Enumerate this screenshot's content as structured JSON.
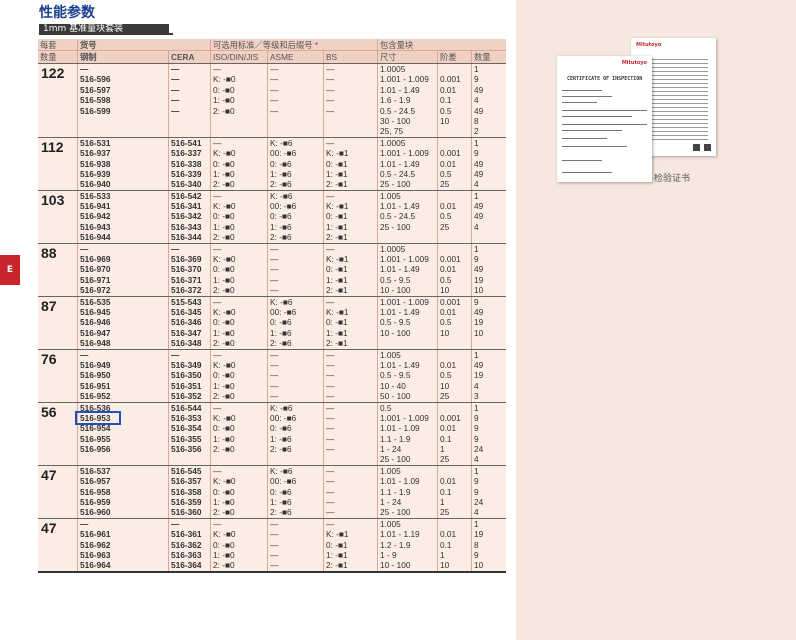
{
  "page": {
    "title": "性能参数",
    "subtitle": "1mm 基准量块套装",
    "side_tab": "E",
    "certificate_caption": "检验证书",
    "certificate_title": "CERTIFICATE OF INSPECTION",
    "certificate_logo": "Mitutoyo"
  },
  "table": {
    "headers": {
      "qty": "每套",
      "qty2": "数量",
      "part_no": "货号",
      "steel": "钢制",
      "cera": "CERA",
      "grade": "可选用标准／等级和后缀号 *",
      "iso": "ISO/DIN/JIS",
      "asme": "ASME",
      "bs": "BS",
      "blocks": "包含量块",
      "size": "尺寸",
      "step": "阶差",
      "count": "数量"
    },
    "groups": [
      {
        "qty": "122",
        "steel": [
          "—",
          "516-596",
          "516-597",
          "516-598",
          "516-599"
        ],
        "cera": [
          "—",
          "—",
          "—",
          "—",
          "—"
        ],
        "iso": [
          "—",
          "K: -■0",
          "0: -■0",
          "1: -■0",
          "2: -■0"
        ],
        "asme": [
          "—",
          "—",
          "—",
          "—",
          "—"
        ],
        "bs": [
          "—",
          "—",
          "—",
          "—",
          "—"
        ],
        "size": [
          "1.0005",
          "1.001 - 1.009",
          "1.01 - 1.49",
          "1.6 - 1.9",
          "0.5 - 24.5",
          "30 - 100",
          "25, 75"
        ],
        "step": [
          "",
          "0.001",
          "0.01",
          "0.1",
          "0.5",
          "10",
          ""
        ],
        "count": [
          "1",
          "9",
          "49",
          "4",
          "49",
          "8",
          "2"
        ]
      },
      {
        "qty": "112",
        "steel": [
          "516-531",
          "516-937",
          "516-938",
          "516-939",
          "516-940"
        ],
        "cera": [
          "516-541",
          "516-337",
          "516-338",
          "516-339",
          "516-340"
        ],
        "iso": [
          "—",
          "K: -■0",
          "0: -■0",
          "1: -■0",
          "2: -■0"
        ],
        "asme": [
          "K: -■6",
          "00: -■6",
          "0: -■6",
          "1: -■6",
          "2: -■6"
        ],
        "bs": [
          "—",
          "K: -■1",
          "0: -■1",
          "1: -■1",
          "2: -■1"
        ],
        "size": [
          "1.0005",
          "1.001 - 1.009",
          "1.01 - 1.49",
          "0.5 - 24.5",
          "25 - 100"
        ],
        "step": [
          "",
          "0.001",
          "0.01",
          "0.5",
          "25"
        ],
        "count": [
          "1",
          "9",
          "49",
          "49",
          "4"
        ]
      },
      {
        "qty": "103",
        "steel": [
          "516-533",
          "516-941",
          "516-942",
          "516-943",
          "516-944"
        ],
        "cera": [
          "516-542",
          "516-341",
          "516-342",
          "516-343",
          "516-344"
        ],
        "iso": [
          "—",
          "K: -■0",
          "0: -■0",
          "1: -■0",
          "2: -■0"
        ],
        "asme": [
          "K: -■6",
          "00: -■6",
          "0: -■6",
          "1: -■6",
          "2: -■6"
        ],
        "bs": [
          "—",
          "K: -■1",
          "0: -■1",
          "1: -■1",
          "2: -■1"
        ],
        "size": [
          "1.005",
          "1.01 - 1.49",
          "0.5 - 24.5",
          "25 - 100",
          ""
        ],
        "step": [
          "",
          "0.01",
          "0.5",
          "25",
          ""
        ],
        "count": [
          "1",
          "49",
          "49",
          "4",
          ""
        ]
      },
      {
        "qty": "88",
        "steel": [
          "—",
          "516-969",
          "516-970",
          "516-971",
          "516-972"
        ],
        "cera": [
          "—",
          "516-369",
          "516-370",
          "516-371",
          "516-372"
        ],
        "iso": [
          "—",
          "K: -■0",
          "0: -■0",
          "1: -■0",
          "2: -■0"
        ],
        "asme": [
          "—",
          "—",
          "—",
          "—",
          "—"
        ],
        "bs": [
          "—",
          "K: -■1",
          "0: -■1",
          "1: -■1",
          "2: -■1"
        ],
        "size": [
          "1.0005",
          "1.001 - 1.009",
          "1.01 - 1.49",
          "0.5 - 9.5",
          "10 - 100"
        ],
        "step": [
          "",
          "0.001",
          "0.01",
          "0.5",
          "10"
        ],
        "count": [
          "1",
          "9",
          "49",
          "19",
          "10"
        ]
      },
      {
        "qty": "87",
        "steel": [
          "516-535",
          "516-945",
          "516-946",
          "516-947",
          "516-948"
        ],
        "cera": [
          "515-543",
          "516-345",
          "516-346",
          "516-347",
          "516-348"
        ],
        "iso": [
          "—",
          "K: -■0",
          "0: -■0",
          "1: -■0",
          "2: -■0"
        ],
        "asme": [
          "K: -■6",
          "00: -■6",
          "0: -■6",
          "1: -■6",
          "2: -■6"
        ],
        "bs": [
          "—",
          "K: -■1",
          "0: -■1",
          "1: -■1",
          "2: -■1"
        ],
        "size": [
          "1.001 - 1.009",
          "1.01 - 1.49",
          "0.5 - 9.5",
          "10 - 100",
          ""
        ],
        "step": [
          "0.001",
          "0.01",
          "0.5",
          "10",
          ""
        ],
        "count": [
          "9",
          "49",
          "19",
          "10",
          ""
        ]
      },
      {
        "qty": "76",
        "steel": [
          "—",
          "516-949",
          "516-950",
          "516-951",
          "516-952"
        ],
        "cera": [
          "—",
          "516-349",
          "516-350",
          "516-351",
          "516-352"
        ],
        "iso": [
          "—",
          "K: -■0",
          "0: -■0",
          "1: -■0",
          "2: -■0"
        ],
        "asme": [
          "—",
          "—",
          "—",
          "—",
          "—"
        ],
        "bs": [
          "—",
          "—",
          "—",
          "—",
          "—"
        ],
        "size": [
          "1.005",
          "1.01 - 1.49",
          "0.5 - 9.5",
          "10 - 40",
          "50 - 100"
        ],
        "step": [
          "",
          "0.01",
          "0.5",
          "10",
          "25"
        ],
        "count": [
          "1",
          "49",
          "19",
          "4",
          "3"
        ]
      },
      {
        "qty": "56",
        "steel": [
          "516-536",
          "516-953",
          "516-954",
          "516-955",
          "516-956"
        ],
        "cera": [
          "516-544",
          "516-353",
          "516-354",
          "516-355",
          "516-356"
        ],
        "iso": [
          "—",
          "K: -■0",
          "0: -■0",
          "1: -■0",
          "2: -■0"
        ],
        "asme": [
          "K: -■6",
          "00: -■6",
          "0: -■6",
          "1: -■6",
          "2: -■6"
        ],
        "bs": [
          "—",
          "—",
          "—",
          "—",
          "—"
        ],
        "size": [
          "0.5",
          "1.001 - 1.009",
          "1.01 - 1.09",
          "1.1 - 1.9",
          "1 - 24",
          "25 - 100"
        ],
        "step": [
          "",
          "0.001",
          "0.01",
          "0.1",
          "1",
          "25"
        ],
        "count": [
          "1",
          "9",
          "9",
          "9",
          "24",
          "4"
        ]
      },
      {
        "qty": "47",
        "steel": [
          "516-537",
          "516-957",
          "516-958",
          "516-959",
          "516-960"
        ],
        "cera": [
          "516-545",
          "516-357",
          "516-358",
          "516-359",
          "516-360"
        ],
        "iso": [
          "—",
          "K: -■0",
          "0: -■0",
          "1: -■0",
          "2: -■0"
        ],
        "asme": [
          "K: -■6",
          "00: -■6",
          "0: -■6",
          "1: -■6",
          "2: -■6"
        ],
        "bs": [
          "—",
          "—",
          "—",
          "—",
          "—"
        ],
        "size": [
          "1.005",
          "1.01 - 1.09",
          "1.1 - 1.9",
          "1 - 24",
          "25 - 100"
        ],
        "step": [
          "",
          "0.01",
          "0.1",
          "1",
          "25"
        ],
        "count": [
          "1",
          "9",
          "9",
          "24",
          "4"
        ]
      },
      {
        "qty": "47",
        "steel": [
          "—",
          "516-961",
          "516-962",
          "516-963",
          "516-964"
        ],
        "cera": [
          "—",
          "516-361",
          "516-362",
          "516-363",
          "516-364"
        ],
        "iso": [
          "—",
          "K: -■0",
          "0: -■0",
          "1: -■0",
          "2: -■0"
        ],
        "asme": [
          "—",
          "—",
          "—",
          "—",
          "—"
        ],
        "bs": [
          "—",
          "K: -■1",
          "0: -■1",
          "1: -■1",
          "2: -■1"
        ],
        "size": [
          "1.005",
          "1.01 - 1.19",
          "1.2 - 1.9",
          "1 - 9",
          "10 - 100"
        ],
        "step": [
          "",
          "0.01",
          "0.1",
          "1",
          "10"
        ],
        "count": [
          "1",
          "19",
          "8",
          "9",
          "10"
        ]
      }
    ]
  }
}
